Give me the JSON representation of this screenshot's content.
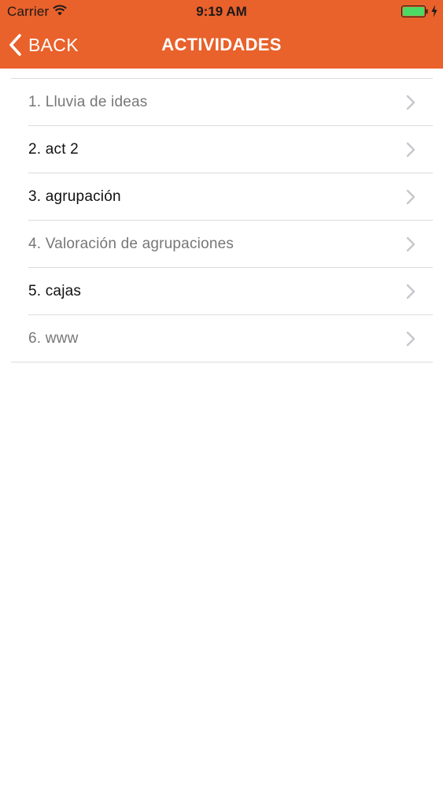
{
  "status_bar": {
    "carrier": "Carrier",
    "time": "9:19 AM",
    "battery_color": "#4cd964"
  },
  "nav": {
    "back_label": "BACK",
    "title": "ACTIVIDADES",
    "background_color": "#e9612b"
  },
  "activities": [
    {
      "label": "1. Lluvia de ideas",
      "state": "dimmed"
    },
    {
      "label": "2. act 2",
      "state": "active"
    },
    {
      "label": "3. agrupación",
      "state": "active"
    },
    {
      "label": "4. Valoración de agrupaciones",
      "state": "dimmed"
    },
    {
      "label": "5. cajas",
      "state": "active"
    },
    {
      "label": "6. www",
      "state": "dimmed"
    }
  ],
  "icons": {
    "back": "chevron-left-icon",
    "row": "chevron-right-icon",
    "wifi": "wifi-icon",
    "battery": "battery-icon",
    "charge": "charging-bolt-icon"
  }
}
